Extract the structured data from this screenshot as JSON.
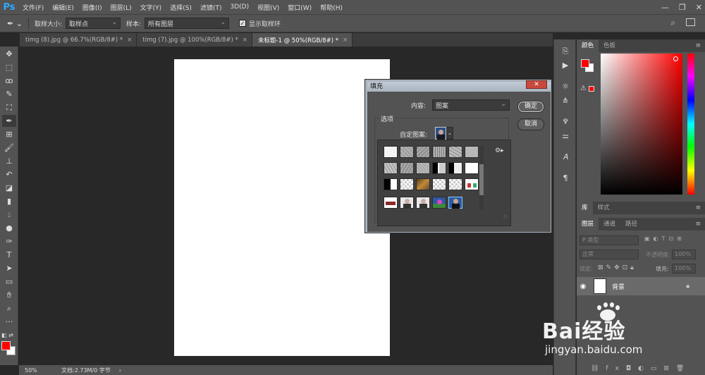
{
  "app": {
    "logo": "Ps"
  },
  "menu": [
    "文件(F)",
    "编辑(E)",
    "图像(I)",
    "图层(L)",
    "文字(Y)",
    "选择(S)",
    "滤镜(T)",
    "3D(D)",
    "视图(V)",
    "窗口(W)",
    "帮助(H)"
  ],
  "window_controls": {
    "minimize": "—",
    "restore": "❐",
    "close": "✕"
  },
  "options": {
    "sample_size_label": "取样大小:",
    "sample_size_value": "取样点",
    "sample_label": "样本:",
    "sample_value": "所有图层",
    "show_ring_label": "显示取样环",
    "show_ring_checked": true
  },
  "tabs": [
    {
      "label": "timg (8).jpg @ 66.7%(RGB/8#) *",
      "close": "×"
    },
    {
      "label": "timg (7).jpg @ 100%(RGB/8#) *",
      "close": "×"
    },
    {
      "label": "未标题-1 @ 50%(RGB/8#) *",
      "close": "×"
    }
  ],
  "status": {
    "zoom": "50%",
    "doc": "文档:2.73M/0 字节",
    "arrow": "›"
  },
  "color_panel": {
    "tabs": [
      "颜色",
      "色板"
    ],
    "foreground": "#ff0000",
    "background": "#ffffff"
  },
  "library_panel": {
    "tabs": [
      "库",
      "样式"
    ]
  },
  "layers_panel": {
    "tabs": [
      "图层",
      "通道",
      "路径"
    ],
    "filter_label": "P 类型",
    "blend_mode": "正常",
    "opacity_label": "不透明度:",
    "opacity_value": "100%",
    "lock_label": "锁定:",
    "fill_label": "填充:",
    "fill_value": "100%",
    "layers": [
      {
        "name": "背景",
        "visible": true,
        "locked": true
      }
    ]
  },
  "fill_dialog": {
    "title": "填充",
    "close": "✕",
    "content_label": "内容:",
    "content_value": "图案",
    "ok": "确定",
    "cancel": "取消",
    "options_label": "选项",
    "custom_pattern_label": "自定图案:"
  },
  "watermark": {
    "brand": "Bai经验",
    "url": "jingyan.baidu.com"
  }
}
